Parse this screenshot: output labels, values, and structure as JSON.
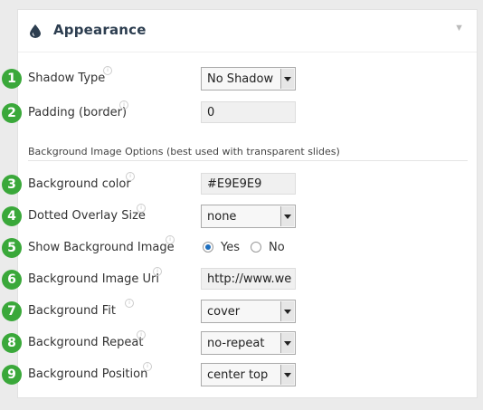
{
  "panel": {
    "title": "Appearance",
    "icons": {
      "panel": "drop-icon",
      "collapse": "triangle-down-icon",
      "help": "info-icon"
    }
  },
  "section_title": "Background Image Options (best used with transparent slides)",
  "rows": [
    {
      "number": "1",
      "label": "Shadow Type",
      "control": "select",
      "value": "No Shadow"
    },
    {
      "number": "2",
      "label": "Padding (border)",
      "control": "text",
      "value": "0"
    },
    {
      "number": "3",
      "label": "Background color",
      "control": "text",
      "value": "#E9E9E9"
    },
    {
      "number": "4",
      "label": "Dotted Overlay Size",
      "control": "select",
      "value": "none"
    },
    {
      "number": "5",
      "label": "Show Background Image",
      "control": "radio",
      "options": [
        {
          "label": "Yes",
          "checked": true
        },
        {
          "label": "No",
          "checked": false
        }
      ]
    },
    {
      "number": "6",
      "label": "Background Image Url",
      "control": "text",
      "value": "http://www.we"
    },
    {
      "number": "7",
      "label": "Background Fit",
      "control": "select",
      "value": "cover"
    },
    {
      "number": "8",
      "label": "Background Repeat",
      "control": "select",
      "value": "no-repeat"
    },
    {
      "number": "9",
      "label": "Background Position",
      "control": "select",
      "value": "center top"
    }
  ],
  "colors": {
    "badge": "#3aa83a",
    "title": "#2d3e50",
    "radio_selected": "#1e6fbf"
  }
}
